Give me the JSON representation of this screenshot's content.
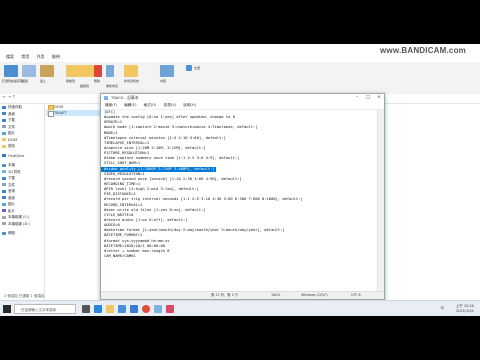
{
  "watermark": "www.BANDICAM.com",
  "explorer": {
    "tabs": [
      "檔案",
      "常用",
      "共用",
      "檢視"
    ],
    "ribbon_labels": [
      "釘選到快速存取",
      "複製",
      "貼上",
      "移動到",
      "複製到",
      "刪除",
      "重新命名",
      "新增資料夾",
      "內容",
      "全選"
    ],
    "nav_items": [
      "快速存取",
      "桌面",
      "下載",
      "文件",
      "圖片",
      "DCIM",
      "視訊",
      "OneDrive",
      "本機",
      "3D 物件",
      "下載",
      "文件",
      "音樂",
      "桌面",
      "圖片",
      "影片",
      "本機磁碟 (C:)",
      "本機磁碟 (D:)",
      "網路"
    ],
    "files": [
      {
        "name": "DCIM",
        "selected": false
      },
      {
        "name": "TRAJET",
        "selected": true
      }
    ],
    "status": "2 個項目  已選取 1 個項目"
  },
  "notepad": {
    "title": "TRACK - 記事本",
    "menu": [
      "檔案(F)",
      "編輯(E)",
      "格式(O)",
      "檢視(V)",
      "說明(H)"
    ],
    "lines": [
      "[DTC]",
      "#update the config [0:no 1:yes] after updated, change to 0",
      "UPDATE=1",
      "#work mode [1:capture 2:movie 3:capture+movie 4:Timelapse, default:]",
      "MODE=1",
      "#Timelapse interval minutes [1:5 2:10 3:60], default:]",
      "TIMELAPSE_INTERVAL=1",
      "#capture size [1:20M 2:16M, 3:12M], default:]",
      "PICTURE_RESOLUTION=1",
      "#take capture numbers once time [1:1 2:3 3:6 4:9], default:]",
      "STILL_SHOT_NUM=1",
      "#video quality [1:1080P 2:720P 3:480P], default:]",
      "VIDEO_RESOLUTION=1",
      "#record second once [second] [1:10 2:30 3:60 4:90], default:]",
      "RECORDING_TIME=1",
      "#PIR level [1:high 2:mid 3:low], default:]",
      "PIR_DISTANCE=2",
      "#record pir trig interval seconds [1:1 2:5 3:10 4:30 5:60 6:300 7:600 8:1800], default:]",
      "RECORD_INTERVAL=1",
      "#over write old files [1:yes 0:no], default:]",
      "CYCLE_WRITE=0",
      "#record audio [1:on 0:off], default:]",
      "AUDIO=0",
      "#datetime format [1:year/month/day 2:day/month/year 3:month/day/year], default:]",
      "DATETIME_FORMAT=1",
      "#format sys:yyyymmdd hh:mm:ss",
      "DATETIME=2020/10/1 00:00:00",
      "#letter + number max:length 8",
      "CAM_NAME=CAM01"
    ],
    "highlight_line": 11,
    "status": {
      "position": "第 12 列，第 1 行",
      "zoom": "100%",
      "eol": "Windows (CRLF)",
      "encoding": "UTF-8"
    }
  },
  "taskbar": {
    "search_placeholder": "在這裡輸入文字來搜尋",
    "tray_time": "上午 10:20",
    "tray_date": "2021/10/1",
    "language": "中"
  },
  "colors": {
    "selection": "#0078d7",
    "file_selected": "#cce8ff",
    "taskbar": "#e9eef4"
  }
}
